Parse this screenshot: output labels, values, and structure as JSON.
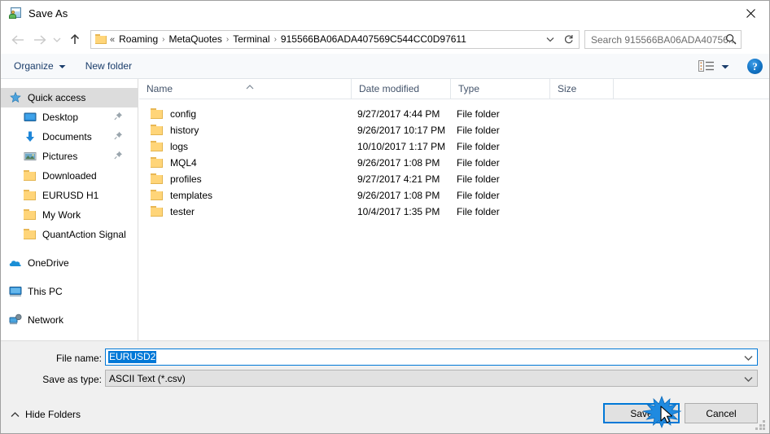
{
  "window": {
    "title": "Save As",
    "icon": "save-as-icon",
    "close_label": "✕"
  },
  "nav": {
    "back": "←",
    "forward": "→",
    "recent": "⌄",
    "up": "↑",
    "refresh": "↻",
    "dropdown": "⌄"
  },
  "breadcrumb": {
    "folder_icon": "folder-icon",
    "overflow": "«",
    "separator": "›",
    "items": [
      "Roaming",
      "MetaQuotes",
      "Terminal",
      "915566BA06ADA407569C544CC0D97611"
    ]
  },
  "search": {
    "placeholder": "Search 915566BA06ADA40756...",
    "icon": "search-icon"
  },
  "toolbar": {
    "organize_label": "Organize",
    "organize_caret": "▾",
    "new_folder_label": "New folder",
    "view_caret": "▾",
    "help_label": "?"
  },
  "sidebar": {
    "items": [
      {
        "label": "Quick access",
        "icon": "star-pin-icon",
        "selected": true,
        "pinned": false,
        "indent": "group"
      },
      {
        "label": "Desktop",
        "icon": "desktop-icon",
        "selected": false,
        "pinned": true,
        "indent": "sub"
      },
      {
        "label": "Documents",
        "icon": "documents-icon",
        "selected": false,
        "pinned": true,
        "indent": "sub"
      },
      {
        "label": "Pictures",
        "icon": "pictures-icon",
        "selected": false,
        "pinned": true,
        "indent": "sub"
      },
      {
        "label": "Downloaded",
        "icon": "folder-icon",
        "selected": false,
        "pinned": false,
        "indent": "sub"
      },
      {
        "label": "EURUSD H1",
        "icon": "folder-icon",
        "selected": false,
        "pinned": false,
        "indent": "sub"
      },
      {
        "label": "My Work",
        "icon": "folder-icon",
        "selected": false,
        "pinned": false,
        "indent": "sub"
      },
      {
        "label": "QuantAction Signal",
        "icon": "folder-icon",
        "selected": false,
        "pinned": false,
        "indent": "sub"
      },
      {
        "label": "OneDrive",
        "icon": "onedrive-icon",
        "selected": false,
        "pinned": false,
        "indent": "group",
        "spacer_before": true
      },
      {
        "label": "This PC",
        "icon": "this-pc-icon",
        "selected": false,
        "pinned": false,
        "indent": "group",
        "spacer_before": true
      },
      {
        "label": "Network",
        "icon": "network-icon",
        "selected": false,
        "pinned": false,
        "indent": "group",
        "spacer_before": true
      }
    ]
  },
  "filelist": {
    "columns": [
      "Name",
      "Date modified",
      "Type",
      "Size"
    ],
    "sort_column": "Name",
    "sort_caret": "⌃",
    "rows": [
      {
        "name": "config",
        "date": "9/27/2017 4:44 PM",
        "type": "File folder",
        "size": ""
      },
      {
        "name": "history",
        "date": "9/26/2017 10:17 PM",
        "type": "File folder",
        "size": ""
      },
      {
        "name": "logs",
        "date": "10/10/2017 1:17 PM",
        "type": "File folder",
        "size": ""
      },
      {
        "name": "MQL4",
        "date": "9/26/2017 1:08 PM",
        "type": "File folder",
        "size": ""
      },
      {
        "name": "profiles",
        "date": "9/27/2017 4:21 PM",
        "type": "File folder",
        "size": ""
      },
      {
        "name": "templates",
        "date": "9/26/2017 1:08 PM",
        "type": "File folder",
        "size": ""
      },
      {
        "name": "tester",
        "date": "10/4/2017 1:35 PM",
        "type": "File folder",
        "size": ""
      }
    ]
  },
  "form": {
    "filename_label": "File name:",
    "filename_value": "EURUSD2",
    "filetype_label": "Save as type:",
    "filetype_value": "ASCII Text (*.csv)",
    "chevron": "⌄"
  },
  "footer": {
    "hide_folders_label": "Hide Folders",
    "hide_folders_caret": "⌃",
    "save_label": "Save",
    "cancel_label": "Cancel"
  },
  "colors": {
    "accent": "#0078d7",
    "folder": "#ffd579",
    "selection": "#dcdcdc",
    "header_text": "#44546b"
  }
}
